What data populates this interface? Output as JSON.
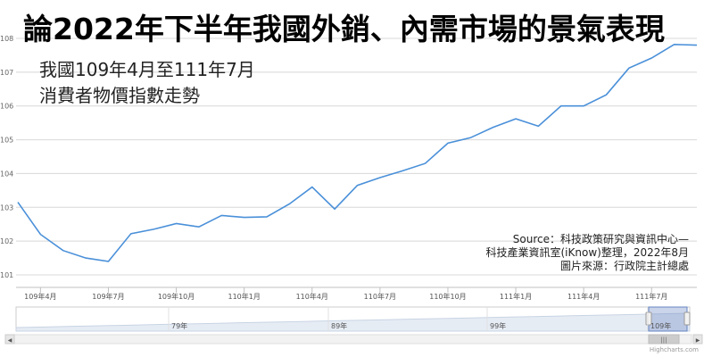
{
  "header": {
    "title": "論2022年下半年我國外銷、內需市場的景氣表現",
    "subtitle_line1": "我國109年4月至111年7月",
    "subtitle_line2": "消費者物價指數走勢"
  },
  "source_note": {
    "line1": "Source：科技政策研究與資訊中心—",
    "line2": "科技產業資訊室(iKnow)整理，2022年8月",
    "line3": "圖片來源：行政院主計總處"
  },
  "credits": "Highcharts.com",
  "colors": {
    "line": "#4a90d9",
    "grid": "#d8d8d8",
    "navigator_fill": "#e6ecf4",
    "handle": "#9aa8ba"
  },
  "chart_data": {
    "type": "line",
    "x": [
      "109年3月",
      "109年4月",
      "109年5月",
      "109年6月",
      "109年7月",
      "109年8月",
      "109年9月",
      "109年10月",
      "109年11月",
      "109年12月",
      "110年1月",
      "110年2月",
      "110年3月",
      "110年4月",
      "110年5月",
      "110年6月",
      "110年7月",
      "110年8月",
      "110年9月",
      "110年10月",
      "110年11月",
      "110年12月",
      "111年1月",
      "111年2月",
      "111年3月",
      "111年4月",
      "111年5月",
      "111年6月",
      "111年7月"
    ],
    "series": [
      {
        "values": [
          103.15,
          102.2,
          101.72,
          101.5,
          101.4,
          102.22,
          102.35,
          102.52,
          102.42,
          102.76,
          102.7,
          102.72,
          103.1,
          103.6,
          102.95,
          103.65,
          103.88,
          104.08,
          104.3,
          104.9,
          105.06,
          105.37,
          105.62,
          105.4,
          106.0,
          106.0,
          106.33,
          107.12,
          107.42,
          107.82,
          107.8
        ]
      }
    ],
    "x_ticks": [
      "109年4月",
      "109年7月",
      "109年10月",
      "110年1月",
      "110年4月",
      "110年7月",
      "110年10月",
      "111年1月",
      "111年4月",
      "111年7月"
    ],
    "y_ticks": [
      "101",
      "102",
      "103",
      "104",
      "105",
      "106",
      "107",
      "108"
    ],
    "ylim": [
      101,
      108
    ],
    "grid": true,
    "legend": "none",
    "navigator": {
      "labels": [
        "79年",
        "89年",
        "99年",
        "109年"
      ],
      "handle_glyph": "|||"
    }
  }
}
